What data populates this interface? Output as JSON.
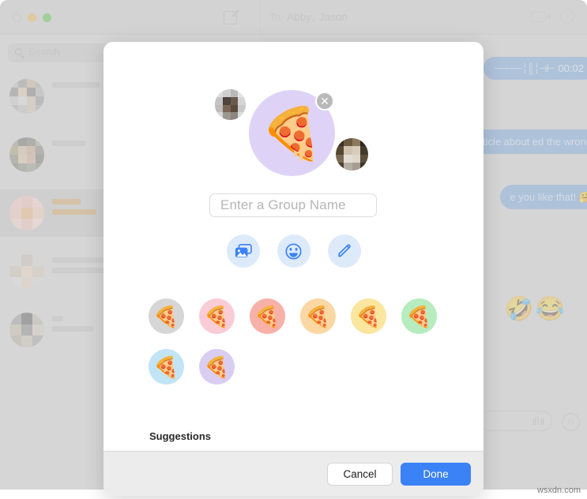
{
  "window": {
    "traffic_lights": [
      "close",
      "minimize",
      "maximize"
    ],
    "compose_icon": "compose-icon",
    "to_label": "To:",
    "recipients": [
      "Abby",
      "Jason"
    ],
    "recipient_separator": ",",
    "facetime_icon": "video-camera-icon",
    "info_icon": "info-icon"
  },
  "sidebar": {
    "search": {
      "placeholder": "Search",
      "icon": "search-icon",
      "value": ""
    },
    "conversations": [
      {
        "name": "",
        "preview": "",
        "redacted": true
      },
      {
        "name": "",
        "preview": "",
        "redacted": true
      },
      {
        "name": "",
        "preview": "",
        "redacted": true,
        "selected": true
      },
      {
        "name": "",
        "preview": "",
        "redacted": true
      },
      {
        "name": "",
        "preview": "",
        "redacted": true
      }
    ]
  },
  "thread": {
    "messages": [
      {
        "type": "audio",
        "duration": "00:02",
        "text": ""
      },
      {
        "type": "text",
        "text": "g an article about\ned the wrong"
      },
      {
        "type": "text",
        "text": "e you like that! 🤗"
      }
    ],
    "reactions": [
      "🤣",
      "😂"
    ],
    "composer": {
      "placeholder": "",
      "value": "",
      "audio_icon": "waveform-icon"
    },
    "composer_emoji_icon": "emoji-icon"
  },
  "dialog": {
    "group_avatar": {
      "emoji": "🍕",
      "background": "#ded3f7",
      "remove_icon": "close-icon"
    },
    "members": [
      {
        "name": "",
        "position": "left"
      },
      {
        "name": "",
        "position": "right"
      }
    ],
    "name_input": {
      "placeholder": "Enter a Group Name",
      "value": ""
    },
    "actions": [
      {
        "id": "photos",
        "icon": "photos-icon",
        "label": "Photos"
      },
      {
        "id": "emoji",
        "icon": "emoji-smiley-icon",
        "label": "Emoji"
      },
      {
        "id": "draw",
        "icon": "pencil-icon",
        "label": "Draw"
      }
    ],
    "swatches": [
      {
        "emoji": "🍕",
        "color": "#d6d6d6",
        "name": "gray"
      },
      {
        "emoji": "🍕",
        "color": "#f9ccd6",
        "name": "pink"
      },
      {
        "emoji": "🍕",
        "color": "#f8b1a8",
        "name": "salmon"
      },
      {
        "emoji": "🍕",
        "color": "#fbd7a4",
        "name": "orange"
      },
      {
        "emoji": "🍕",
        "color": "#fbe6a0",
        "name": "yellow"
      },
      {
        "emoji": "🍕",
        "color": "#b6ecbe",
        "name": "green"
      },
      {
        "emoji": "🍕",
        "color": "#c2e5f6",
        "name": "blue"
      },
      {
        "emoji": "🍕",
        "color": "#dacdf2",
        "name": "purple"
      }
    ],
    "suggestions_label": "Suggestions",
    "cancel_label": "Cancel",
    "done_label": "Done"
  },
  "watermark": "wsxdn.com",
  "colors": {
    "accent": "#3b82f6",
    "bubble": "#7ca8dd",
    "action_bg": "#ddeaf9"
  }
}
